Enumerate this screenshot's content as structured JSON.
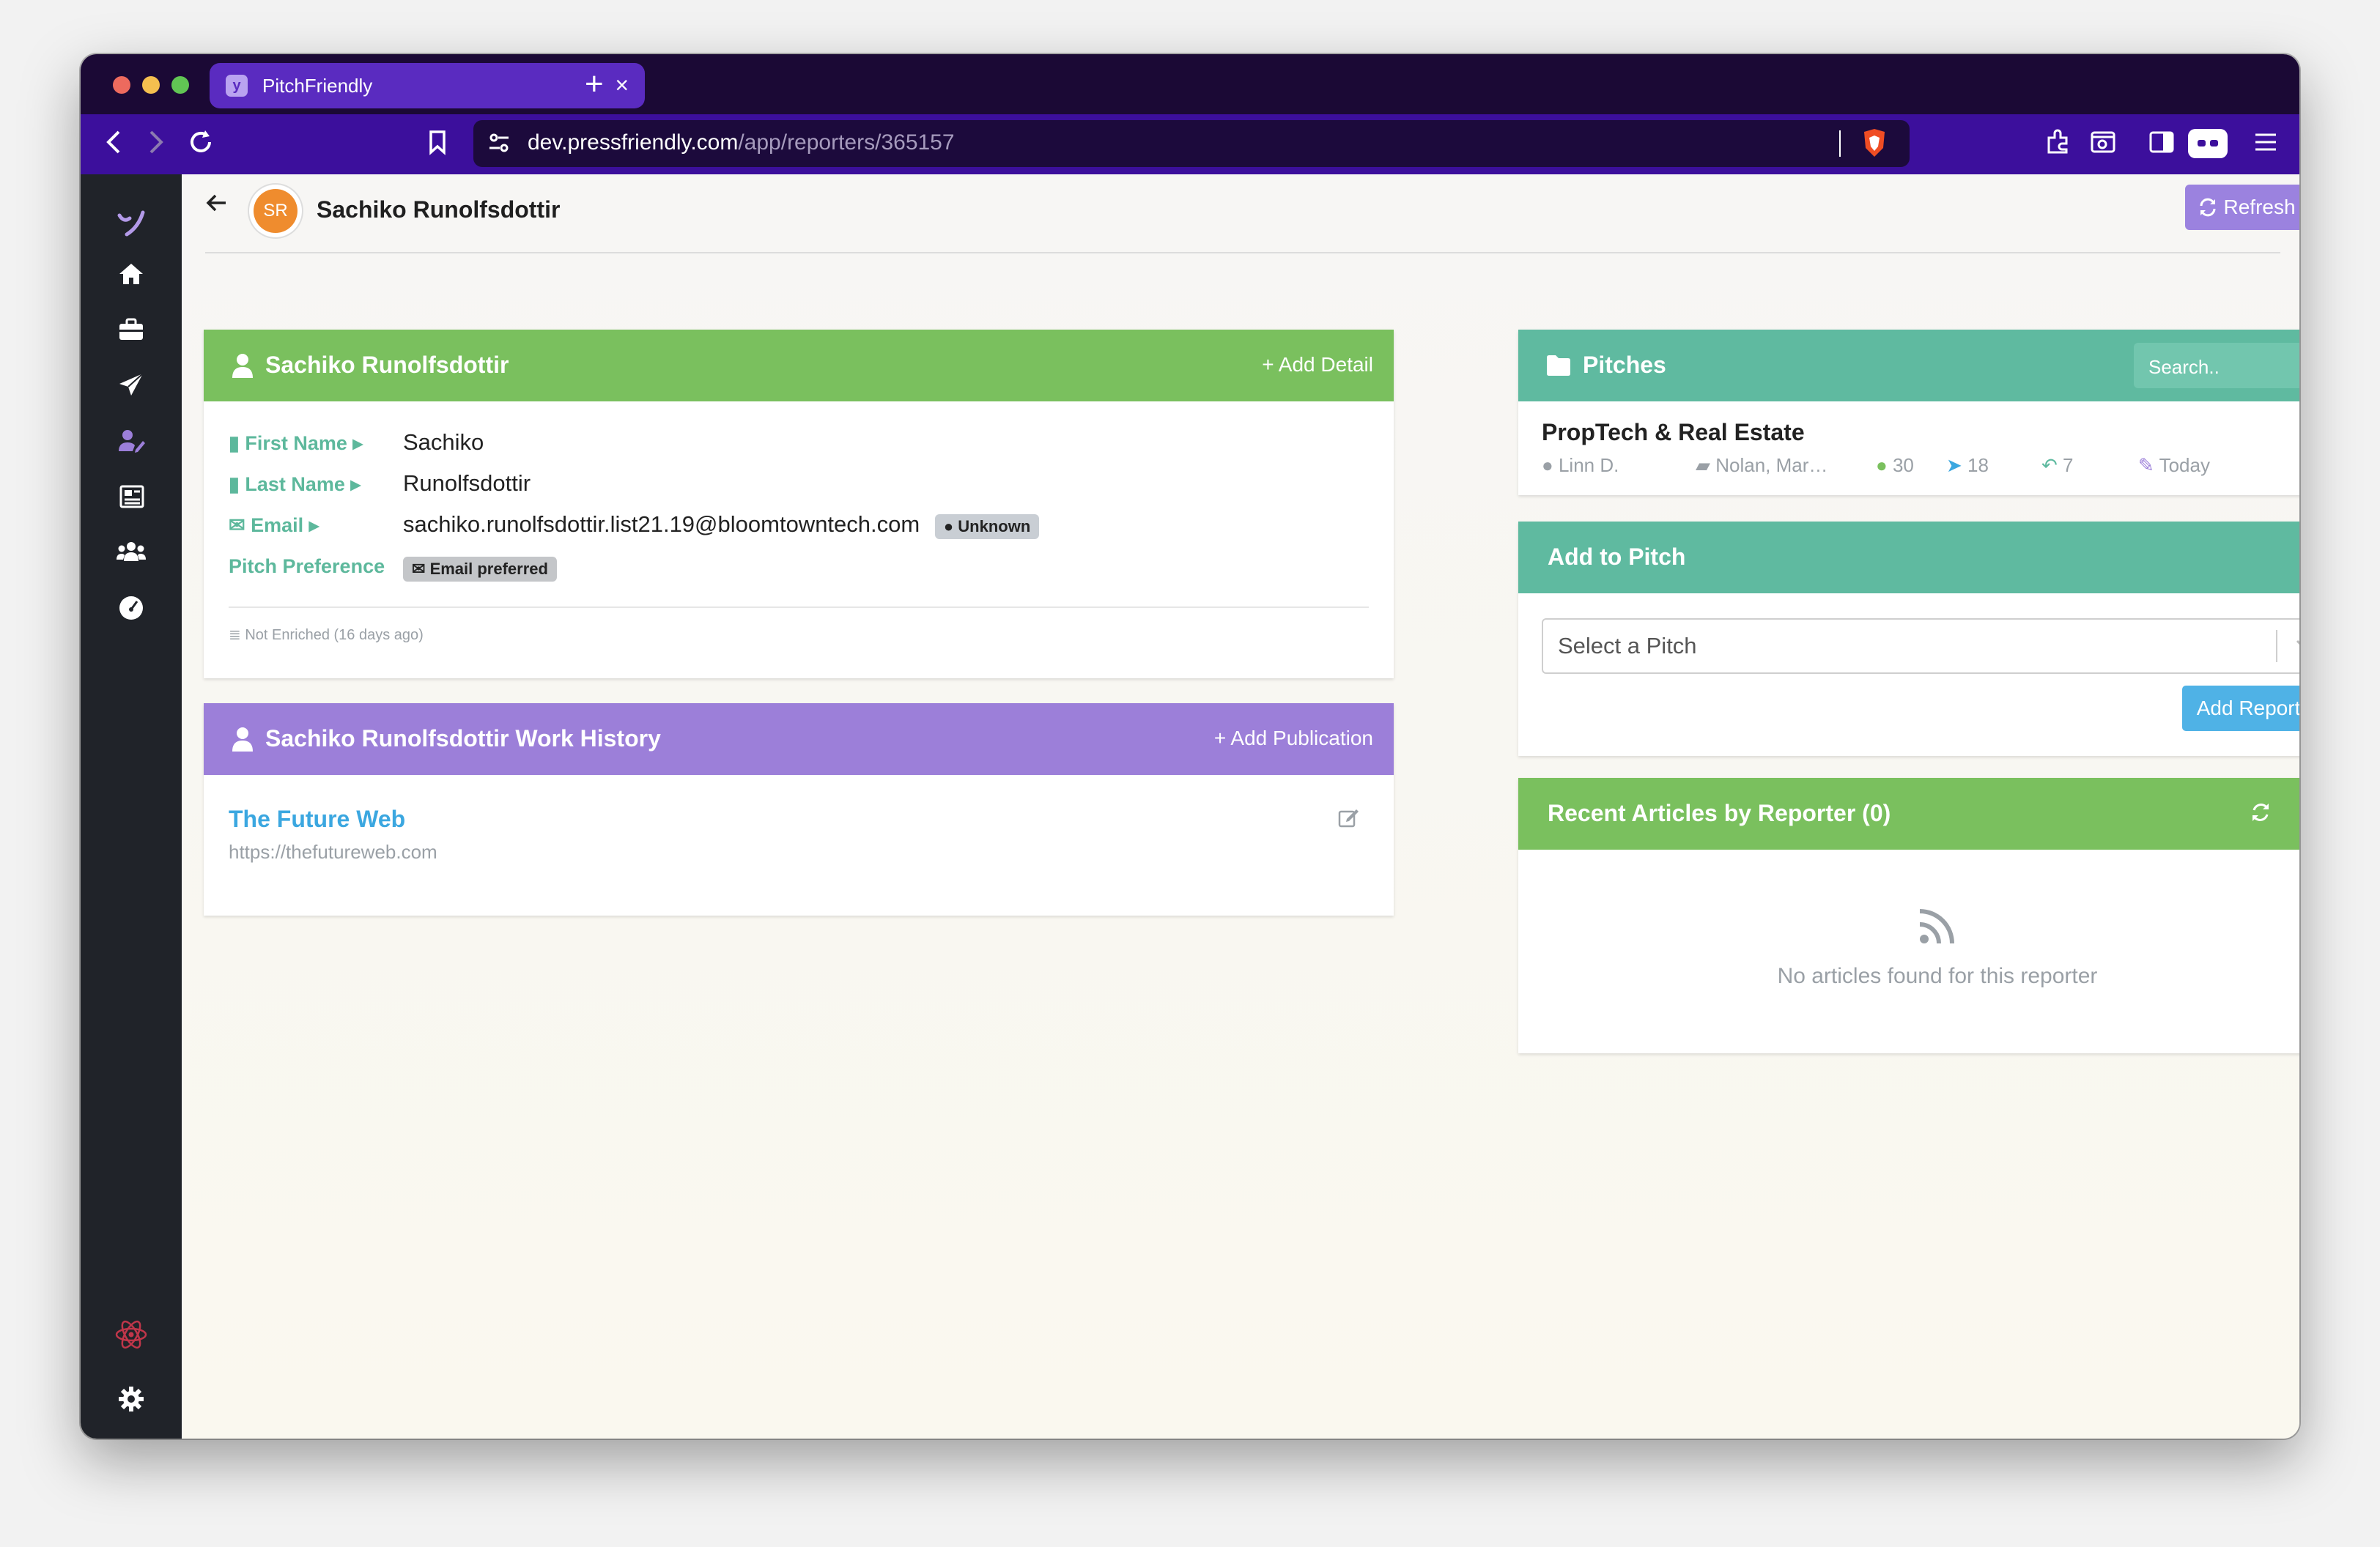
{
  "browser": {
    "tab_title": "PitchFriendly",
    "favicon_letter": "y",
    "url_domain": "dev.pressfriendly.com",
    "url_path": "/app/reporters/365157"
  },
  "header": {
    "avatar_initials": "SR",
    "title": "Sachiko Runolfsdottir",
    "refresh_label": "Refresh Data"
  },
  "details_card": {
    "title": "Sachiko Runolfsdottir",
    "add_detail": "+ Add Detail",
    "first_name_label": "First Name",
    "first_name": "Sachiko",
    "last_name_label": "Last Name",
    "last_name": "Runolfsdottir",
    "email_label": "Email",
    "email": "sachiko.runolfsdottir.list21.19@bloomtowntech.com",
    "email_status": "Unknown",
    "pitch_pref_label": "Pitch Preference",
    "pitch_pref": "Email preferred",
    "enrichment": "Not Enriched (16 days ago)"
  },
  "work_history": {
    "title": "Sachiko Runolfsdottir Work History",
    "add_publication": "+ Add Publication",
    "publication_name": "The Future Web",
    "publication_url": "https://thefutureweb.com"
  },
  "pitches": {
    "title": "Pitches",
    "search_placeholder": "Search..",
    "item": {
      "name": "PropTech & Real Estate",
      "owner": "Linn D.",
      "company": "Nolan, Mar…",
      "reporters": "30",
      "sent": "18",
      "replies": "7",
      "updated": "Today"
    }
  },
  "add_to_pitch": {
    "title": "Add to Pitch",
    "select_placeholder": "Select a Pitch",
    "add_button": "Add Reporter"
  },
  "recent_articles": {
    "title": "Recent Articles by Reporter (0)",
    "empty": "No articles found for this reporter"
  }
}
